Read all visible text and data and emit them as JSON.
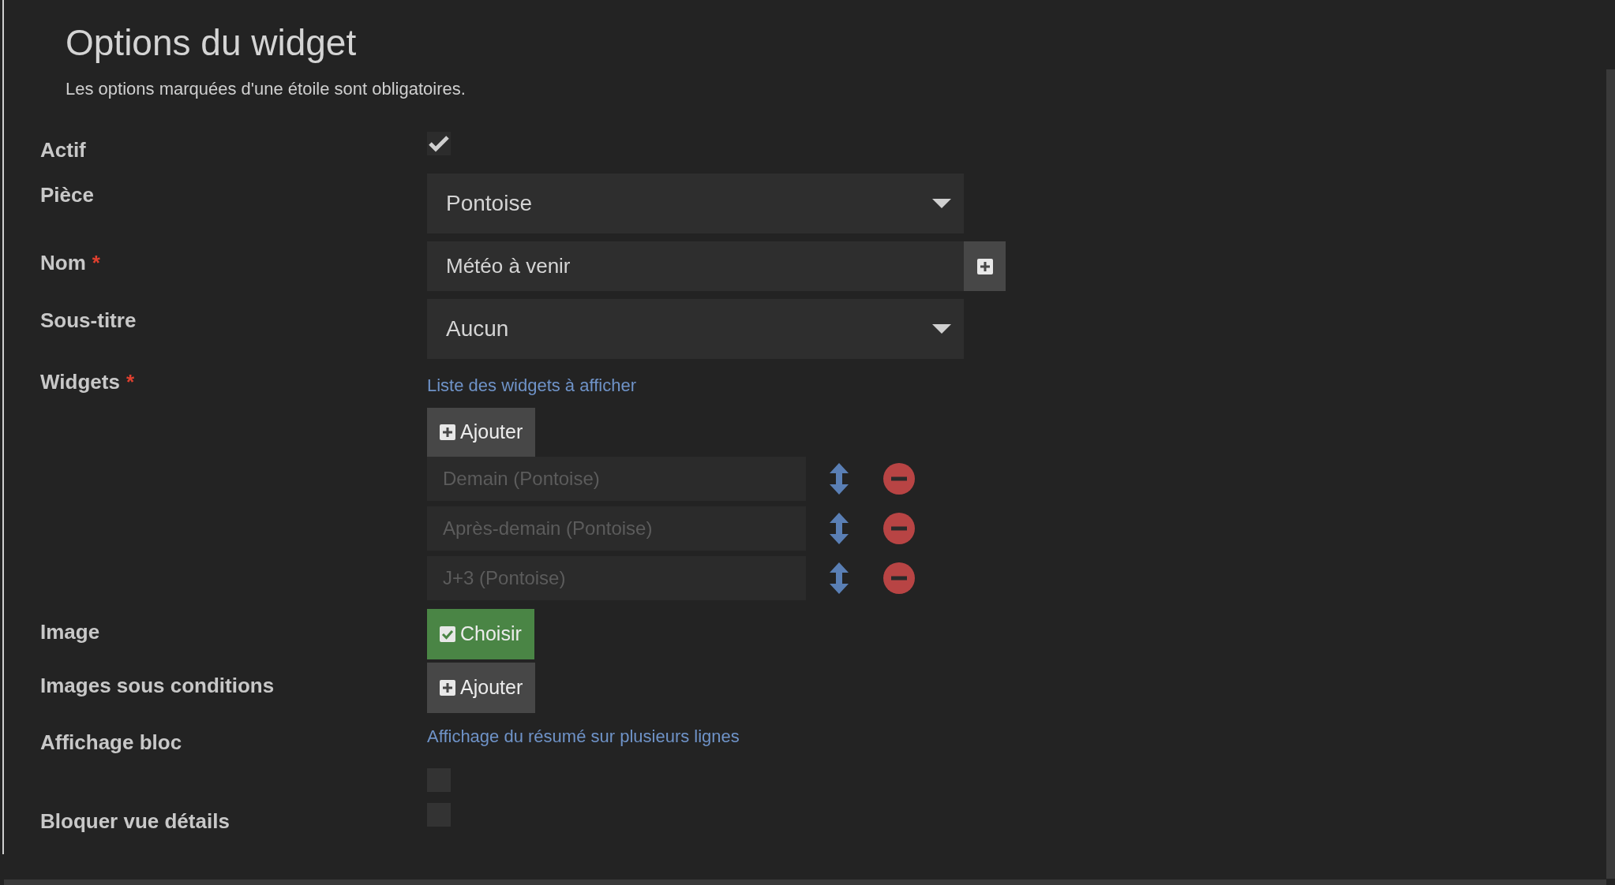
{
  "title": "Options du widget",
  "subtitle": "Les options marquées d'une étoile sont obligatoires.",
  "fields": [
    {
      "kind": "checkbox",
      "label": "Actif",
      "checked": true
    },
    {
      "kind": "select",
      "label": "Pièce",
      "value": "Pontoise"
    },
    {
      "kind": "text",
      "label": "Nom",
      "required_mark": "*",
      "value": "Météo à venir"
    },
    {
      "kind": "select",
      "label": "Sous-titre",
      "value": "Aucun"
    },
    {
      "kind": "list",
      "label": "Widgets",
      "required_mark": "*",
      "help": "Liste des widgets à afficher",
      "button": "Ajouter",
      "items": [
        "Demain (Pontoise)",
        "Après-demain (Pontoise)",
        "J+3 (Pontoise)"
      ]
    },
    {
      "kind": "choose",
      "label": "Image",
      "button": "Choisir"
    },
    {
      "kind": "add",
      "label": "Images sous conditions",
      "button": "Ajouter"
    },
    {
      "kind": "checkbox",
      "label": "Affichage bloc",
      "help": "Affichage du résumé sur plusieurs lignes",
      "checked": false
    },
    {
      "kind": "checkbox",
      "label": "Bloquer vue détails",
      "checked": false
    }
  ]
}
